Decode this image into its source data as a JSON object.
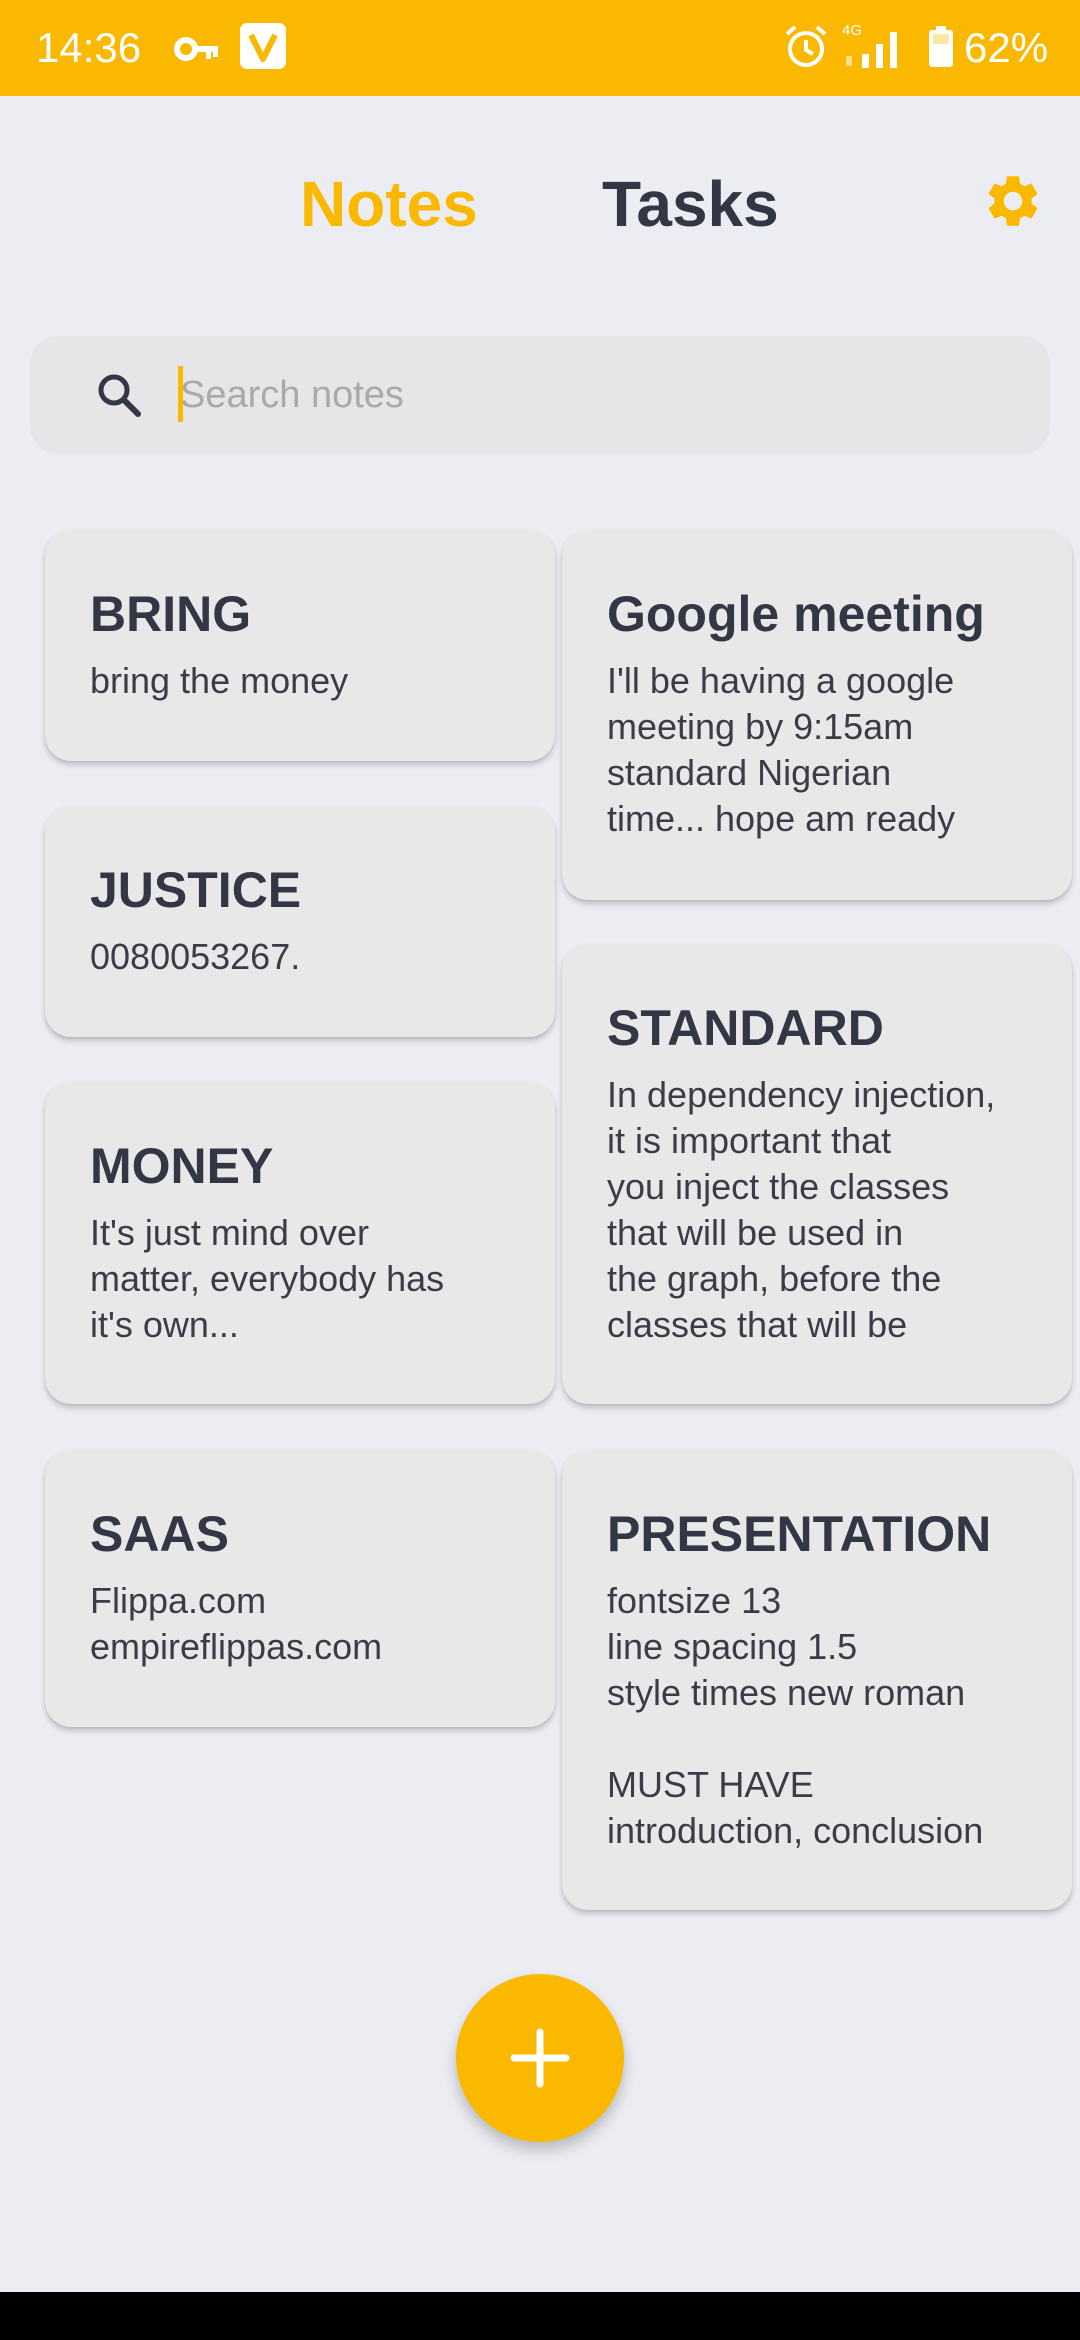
{
  "status_bar": {
    "time": "14:36",
    "network_label": "4G",
    "battery": "62%",
    "icons": [
      "key-icon",
      "vpn-icon",
      "alarm-icon",
      "signal-icon",
      "battery-icon"
    ]
  },
  "header": {
    "tabs": [
      {
        "label": "Notes",
        "active": true
      },
      {
        "label": "Tasks",
        "active": false
      }
    ],
    "settings_icon": "gear-icon"
  },
  "search": {
    "placeholder": "Search notes",
    "value": ""
  },
  "notes": [
    {
      "title": "BRING",
      "body": "bring the money"
    },
    {
      "title": "Google meeting",
      "body": "I'll be having a google\nmeeting by 9:15am\nstandard Nigerian\ntime... hope am ready"
    },
    {
      "title": "JUSTICE",
      "body": "0080053267."
    },
    {
      "title": "STANDARD",
      "body": "In dependency injection,\nit is important that\nyou inject the classes\nthat will be used in\nthe graph, before the\nclasses that will be"
    },
    {
      "title": "MONEY",
      "body": "It's just mind over\nmatter, everybody has\nit's own..."
    },
    {
      "title": "SAAS",
      "body": "Flippa.com\nempireflippas.com"
    },
    {
      "title": "PRESENTATION",
      "body": "fontsize 13\nline spacing 1.5\nstyle times new roman\n\nMUST HAVE\nintroduction, conclusion"
    }
  ],
  "fab": {
    "icon": "plus-icon"
  },
  "colors": {
    "accent": "#FAB800",
    "text": "#333745",
    "background": "#ECEDF3",
    "card": "#E8E8E9"
  }
}
